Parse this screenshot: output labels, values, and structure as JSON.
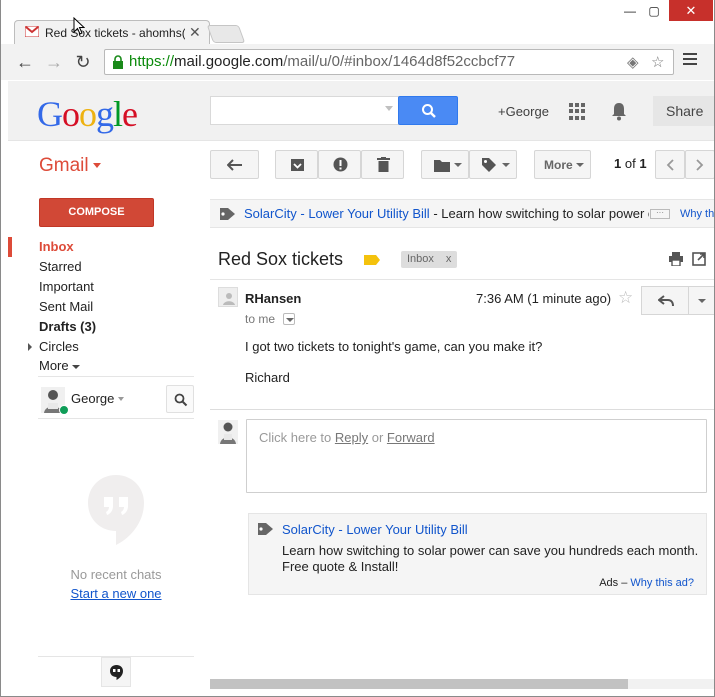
{
  "browser": {
    "tab_title": "Red Sox tickets - ahomhs(",
    "url_scheme": "https://",
    "url_host": "mail.google.com",
    "url_path": "/mail/u/0/#inbox/1464d8f52ccbcf77"
  },
  "header": {
    "logo_letters": [
      "G",
      "o",
      "o",
      "g",
      "l",
      "e"
    ],
    "search_placeholder": "",
    "plus_user": "+George",
    "share_label": "Share"
  },
  "sidebar": {
    "app_label": "Gmail",
    "compose_label": "COMPOSE",
    "items": [
      {
        "label": "Inbox"
      },
      {
        "label": "Starred"
      },
      {
        "label": "Important"
      },
      {
        "label": "Sent Mail"
      },
      {
        "label": "Drafts (3)"
      },
      {
        "label": "Circles"
      },
      {
        "label": "More"
      }
    ],
    "chat_user": "George",
    "no_chats": "No recent chats",
    "start_new": "Start a new one"
  },
  "toolbar": {
    "more_label": "More",
    "pager_current": "1",
    "pager_of": "of",
    "pager_total": "1"
  },
  "adbar": {
    "advertiser": "SolarCity",
    "separator": " - ",
    "headline": "Lower Your Utility Bill",
    "text": "Learn how switching to solar power can save you hundreds each month.",
    "why": "Why this ad?"
  },
  "message": {
    "subject": "Red Sox tickets",
    "chip_label": "Inbox",
    "chip_close": "x",
    "sender": "RHansen",
    "date": "7:36 AM (1 minute ago)",
    "to": "to me",
    "body": [
      "I got two tickets to tonight's game, can you make it?",
      "Richard"
    ]
  },
  "reply": {
    "prefix": "Click here to ",
    "reply": "Reply",
    "or": " or ",
    "forward": "Forward"
  },
  "adcard": {
    "advertiser": "SolarCity",
    "separator": " - ",
    "headline": "Lower Your Utility Bill",
    "lines": [
      "Learn how switching to solar power can save you hundreds each month.",
      "Free quote & Install!"
    ],
    "ads_label": "Ads",
    "dash": " – ",
    "why": "Why this ad?"
  },
  "colors": {
    "gmail_red": "#dd4b39",
    "compose_red": "#d14836",
    "search_blue": "#4a8af4",
    "link_blue": "#1155cc"
  }
}
